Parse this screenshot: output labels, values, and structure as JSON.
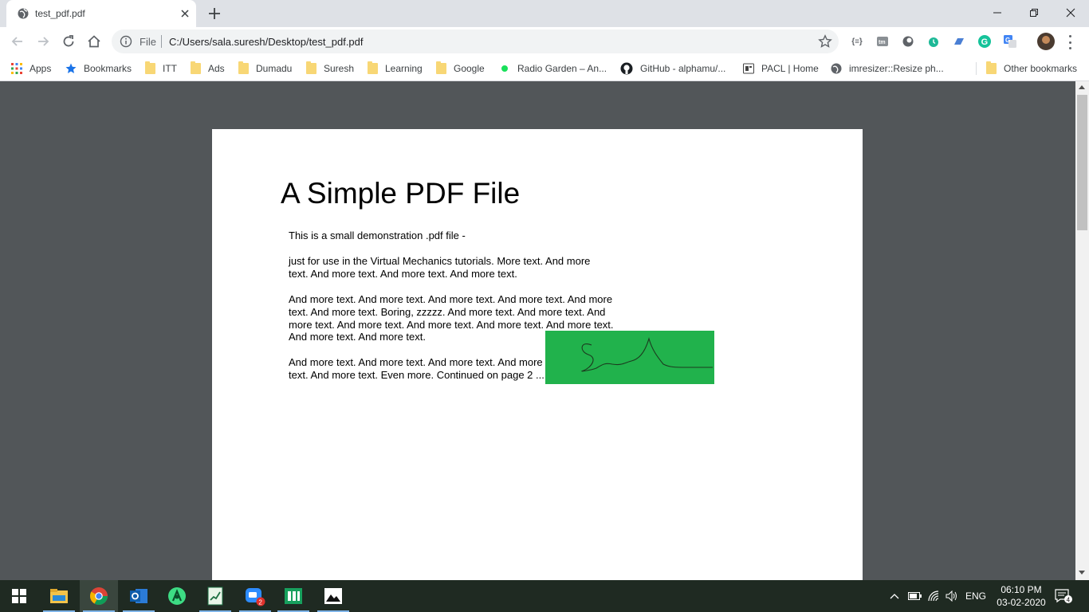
{
  "browser": {
    "tab": {
      "title": "test_pdf.pdf"
    },
    "address": {
      "scheme": "File",
      "url": "C:/Users/sala.suresh/Desktop/test_pdf.pdf"
    },
    "bookmarks": [
      {
        "label": "Apps",
        "icon": "apps-grid-icon"
      },
      {
        "label": "Bookmarks",
        "icon": "star-icon"
      },
      {
        "label": "ITT",
        "icon": "folder-icon"
      },
      {
        "label": "Ads",
        "icon": "folder-icon"
      },
      {
        "label": "Dumadu",
        "icon": "folder-icon"
      },
      {
        "label": "Suresh",
        "icon": "folder-icon"
      },
      {
        "label": "Learning",
        "icon": "folder-icon"
      },
      {
        "label": "Google",
        "icon": "folder-icon"
      },
      {
        "label": "Radio Garden – An...",
        "icon": "radio-garden-icon"
      },
      {
        "label": "GitHub - alphamu/...",
        "icon": "github-icon"
      },
      {
        "label": "PACL | Home",
        "icon": "pacl-icon"
      },
      {
        "label": "imresizer::Resize ph...",
        "icon": "globe-icon"
      }
    ],
    "other_bookmarks": "Other bookmarks"
  },
  "pdf": {
    "title": "A Simple PDF File",
    "paragraphs": [
      "This is a small demonstration .pdf file -",
      "just for use in the Virtual Mechanics tutorials. More text. And more text. And more text. And more text. And more text.",
      "And more text. And more text. And more text. And more text. And more text. And more text. Boring, zzzzz. And more text. And more text. And more text. And more text. And more text. And more text. And more text. And more text. And more text.",
      "And more text. And more text. And more text. And more text. And more text. And more text. Even more. Continued on page 2 ..."
    ],
    "overlay_color": "#21b24c"
  },
  "taskbar": {
    "apps": [
      {
        "name": "file-explorer-icon"
      },
      {
        "name": "chrome-icon"
      },
      {
        "name": "outlook-icon"
      },
      {
        "name": "android-studio-icon"
      },
      {
        "name": "excel-icon"
      },
      {
        "name": "chat-app-icon",
        "badge": "2"
      },
      {
        "name": "sheets-icon"
      },
      {
        "name": "photos-icon"
      }
    ],
    "language": "ENG",
    "time": "06:10 PM",
    "date": "03-02-2020",
    "notifications": "4"
  }
}
